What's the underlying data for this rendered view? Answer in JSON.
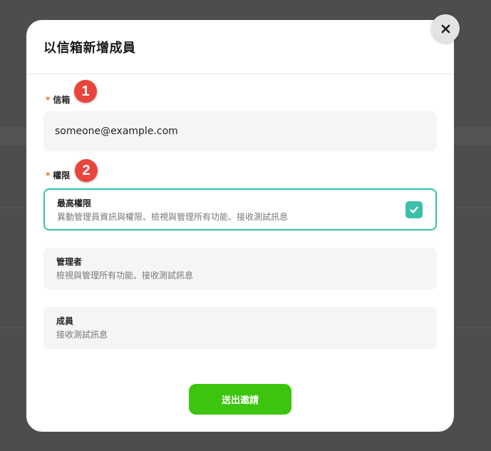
{
  "dialog": {
    "title": "以信箱新增成員",
    "close_label": "✕"
  },
  "form": {
    "required_mark": "*",
    "email": {
      "label": "信箱",
      "value": "someone@example.com",
      "step": "1"
    },
    "permission": {
      "label": "權限",
      "step": "2",
      "options": [
        {
          "title": "最高權限",
          "description": "異動管理員資訊與權限、檢視與管理所有功能、接收測試訊息",
          "selected": true
        },
        {
          "title": "管理者",
          "description": "檢視與管理所有功能、接收測試訊息",
          "selected": false
        },
        {
          "title": "成員",
          "description": "接收測試訊息",
          "selected": false
        }
      ]
    },
    "submit_label": "送出邀請"
  },
  "colors": {
    "accent_teal": "#3bbfa8",
    "submit_green": "#3cc40e",
    "badge_red": "#e8453c",
    "required_orange": "#f0642c",
    "overlay": "#4d4d4d"
  },
  "icons": {
    "close": "close-icon",
    "check": "checkmark-icon"
  }
}
